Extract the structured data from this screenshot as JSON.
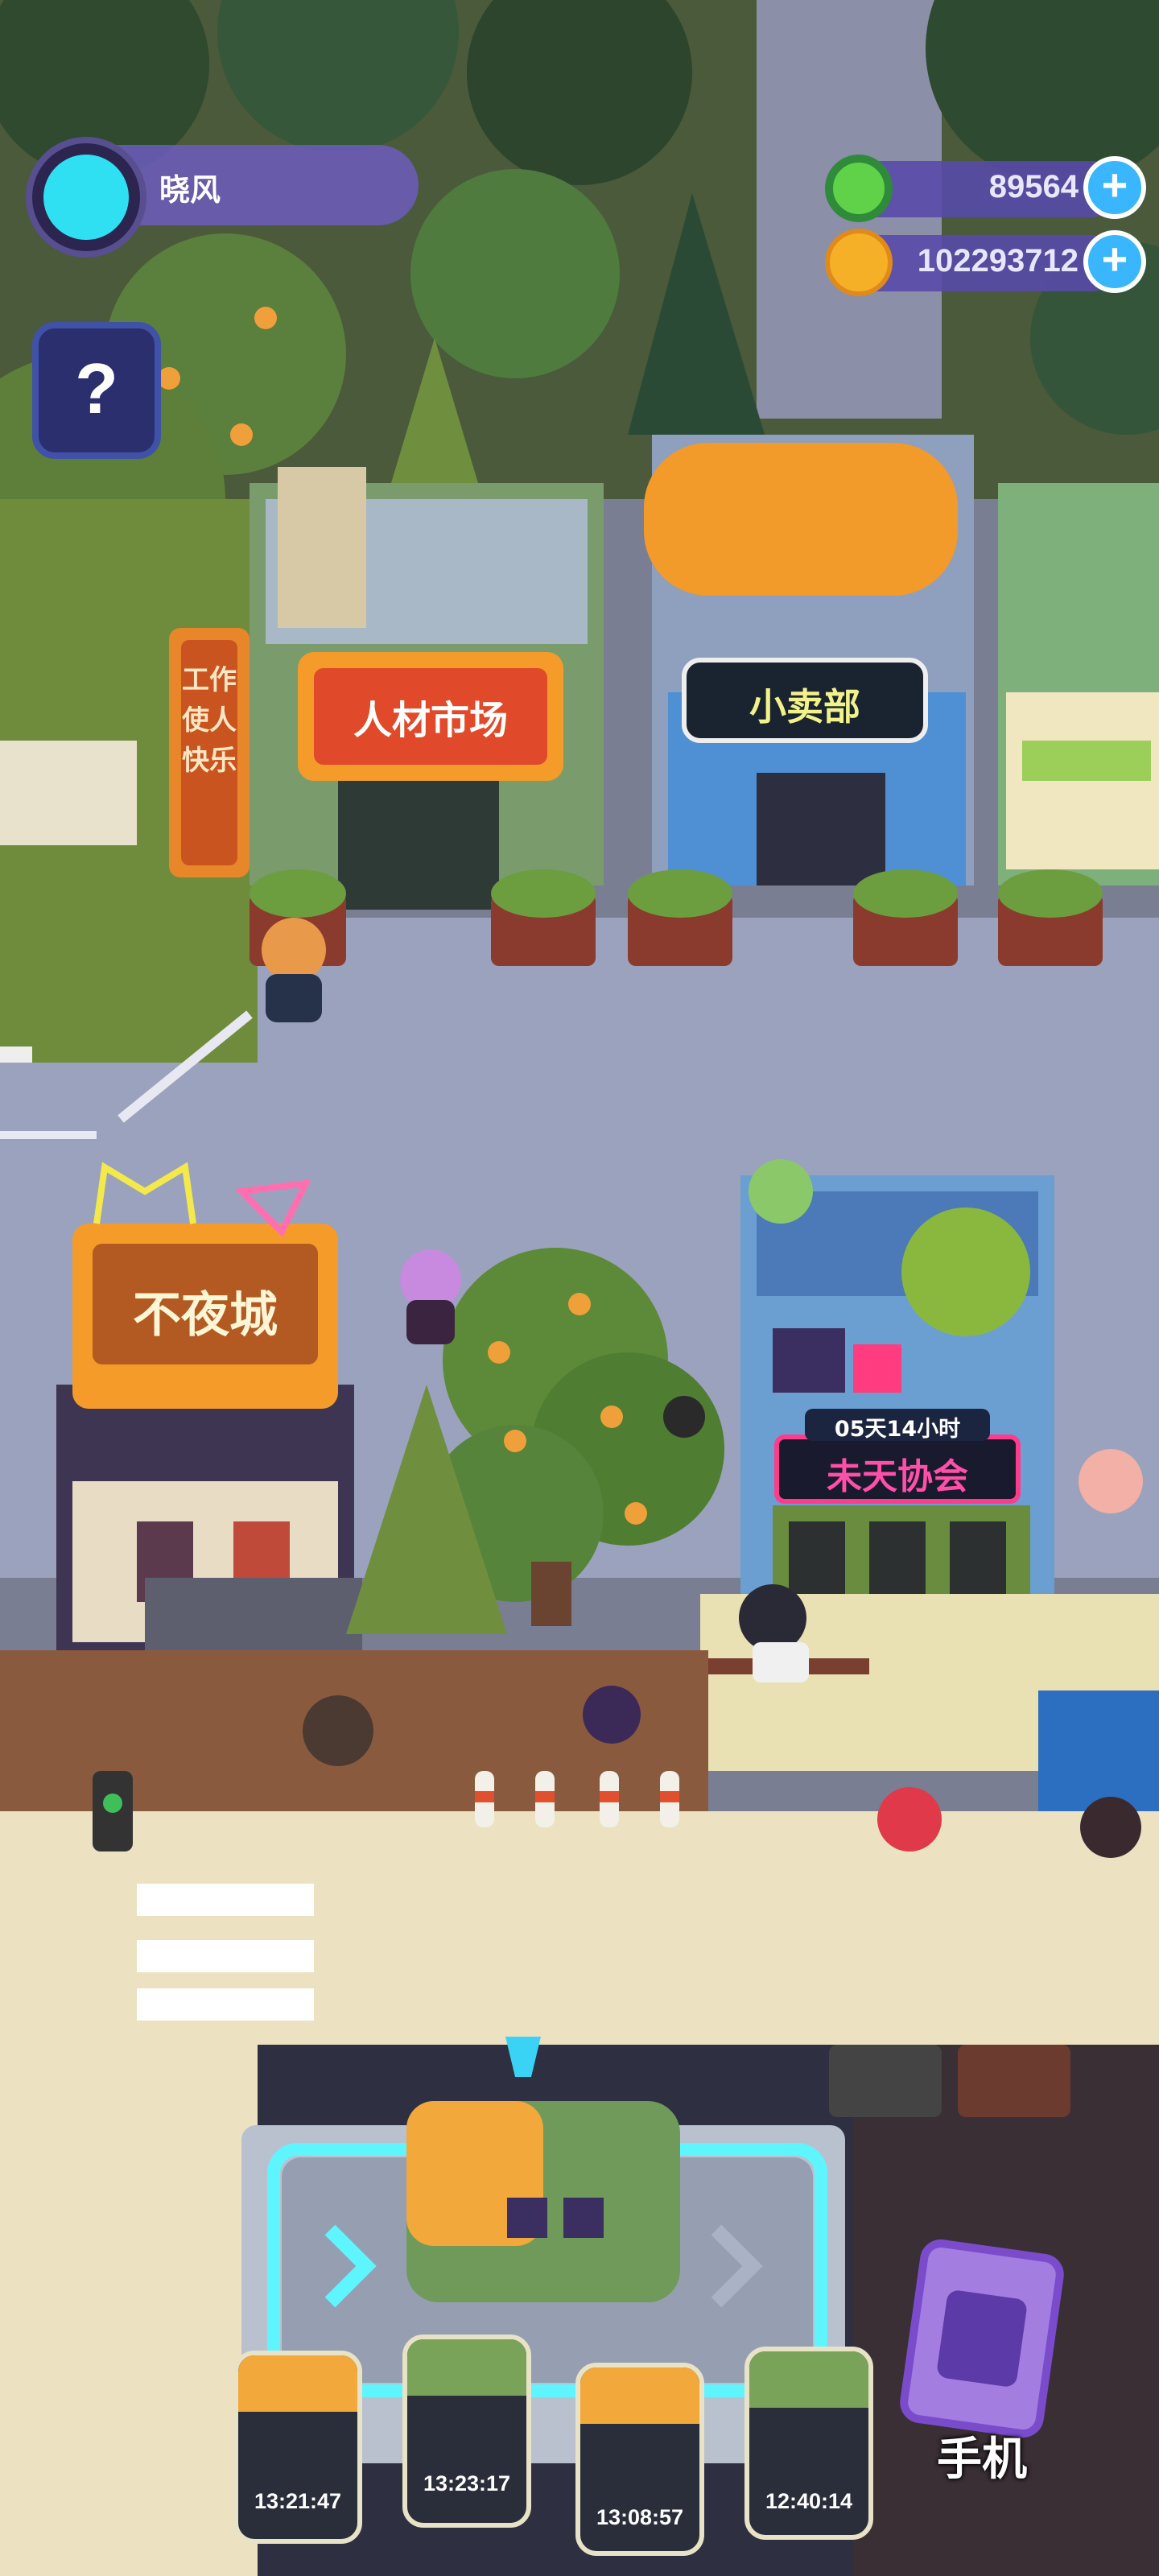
{
  "player": {
    "name": "晓风",
    "avatar_icon": "cat-face-icon"
  },
  "currencies": [
    {
      "icon": "donut-coin-icon",
      "value": "89564"
    },
    {
      "icon": "planet-coin-icon",
      "value": "102293712"
    }
  ],
  "help_button": {
    "icon": "question-mark-icon",
    "label": "?"
  },
  "buildings": {
    "talent_market": "人材市场",
    "banner_vertical": "工作使人快乐",
    "kiosk": "小卖部",
    "nightless_city": "不夜城",
    "association": "未天协会",
    "association_timer": "05天14小时"
  },
  "vehicle_slots": [
    {
      "timer": "13:21:47"
    },
    {
      "timer": "13:23:17"
    },
    {
      "timer": "13:08:57"
    },
    {
      "timer": "12:40:14"
    }
  ],
  "phone_button": {
    "label": "手机",
    "icon": "phone-icon"
  },
  "colors": {
    "hud_purple": "#584aa8",
    "plus_blue": "#3ab6ff",
    "road": "#9ba2bd",
    "grass": "#6f8c3c"
  }
}
